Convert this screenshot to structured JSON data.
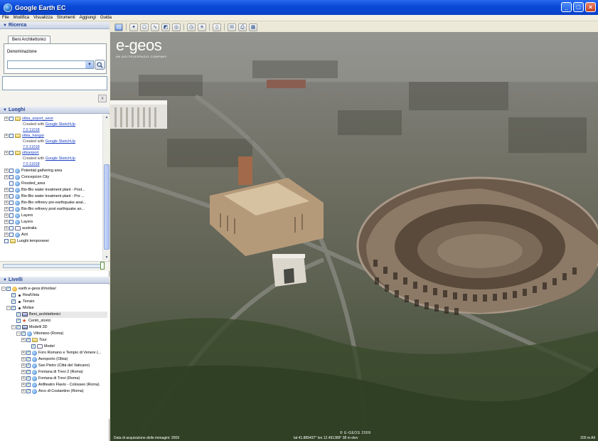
{
  "window": {
    "title": "Google Earth EC"
  },
  "menu": [
    "File",
    "Modifica",
    "Visualizza",
    "Strumenti",
    "Aggiungi",
    "Guida"
  ],
  "search": {
    "header": "Ricerca",
    "tab": "Beni Architettonici",
    "field_label": "Denominazione",
    "field_value": "",
    "close_label": "x"
  },
  "places": {
    "header": "Luoghi",
    "items": [
      {
        "label": "olbia_airport_west",
        "sub": "Created with",
        "sub_link": "Google SketchUp",
        "version": "7.0.11018"
      },
      {
        "label": "olbia_hangar",
        "sub": "Created with",
        "sub_link": "Google SketchUp",
        "version": "7.0.11018"
      },
      {
        "label": "olbiairport",
        "sub": "Created with",
        "sub_link": "Google SketchUp",
        "version": "7.0.11018"
      }
    ],
    "entries": [
      "Potential gathering area",
      "Concepcion City",
      "Flooded_area",
      "Bio-Bio water treatment plant - Post...",
      "Bio-Bio water treatment plant - Pre ...",
      "Bio-Bio refinery pre-earthquake anal...",
      "Bio-Bio refinery post earthquake an...",
      "Layers",
      "Layers",
      "australia",
      "Acti",
      "Luoghi temporanei"
    ]
  },
  "layers": {
    "header": "Livelli",
    "items": [
      "earth.e-geos.it/molise/",
      "RealVista",
      "Terrain",
      "Molise",
      "Beni_architettonici",
      "Centri_storici",
      "Modelli 3D",
      "Vittoriano (Roma)",
      "Tour",
      "Model",
      "Foro Romano e Tempio di Venere (...",
      "Aeroporto (Olbia)",
      "San Pietro (Città del Vaticano)",
      "Fontana di Trevi 2 (Roma)",
      "Fontana di Trevi (Roma)",
      "Anfiteatro Flavio - Colosseo (Roma)",
      "Arco di Costantino (Roma)"
    ]
  },
  "map": {
    "brand": "e-geos",
    "brand_tagline": "AN ASI/TELESPAZIO COMPANY",
    "copyright": "© E-GEOS 2009",
    "status_left": "Data di acquisizione delle immagini: 2009",
    "status_center": "lat  41.889437°  lon  12.491389°      38 m elev",
    "status_right": "205 m Alt"
  },
  "colors": {
    "titlebar": "#0a4bd8",
    "link": "#1a3ec2",
    "panel_header": "#1f3f93"
  }
}
